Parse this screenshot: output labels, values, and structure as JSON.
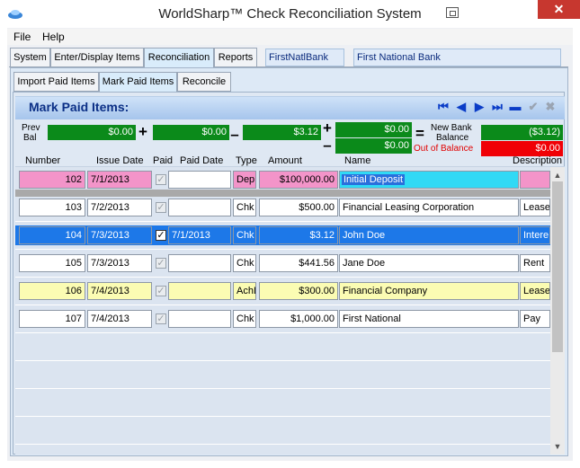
{
  "window": {
    "title": "WorldSharp™ Check Reconciliation System",
    "close_glyph": "✕"
  },
  "menu": [
    "File",
    "Help"
  ],
  "tabs": [
    "System",
    "Enter/Display Items",
    "Reconciliation",
    "Reports"
  ],
  "active_tab": "Reconciliation",
  "bank": {
    "code": "FirstNatlBank",
    "name": "First National Bank"
  },
  "subtabs": [
    "Import Paid Items",
    "Mark Paid Items",
    "Reconcile"
  ],
  "active_subtab": "Mark Paid Items",
  "panel_title": "Mark Paid Items:",
  "nav_icons": [
    "first-record-icon",
    "previous-record-icon",
    "next-record-icon",
    "last-record-icon",
    "delete-icon",
    "save-check-icon",
    "cancel-icon"
  ],
  "balances": {
    "prev_bal_label_1": "Prev",
    "prev_bal_label_2": "Bal",
    "prev_bal": "$0.00",
    "plus_value": "$0.00",
    "minus_value": "$3.12",
    "add_adjust": "$0.00",
    "sub_adjust": "$0.00",
    "new_bank_label_1": "New Bank",
    "new_bank_label_2": "Balance",
    "new_bank_balance": "($3.12)",
    "out_of_balance_label": "Out of Balance",
    "out_of_balance": "$0.00",
    "op_plus": "+",
    "op_minus": "–",
    "op_equals": "="
  },
  "columns": [
    "Number",
    "Issue Date",
    "Paid",
    "Paid Date",
    "Type",
    "Amount",
    "Name",
    "Description"
  ],
  "rows": [
    {
      "number": "102",
      "issue_date": "7/1/2013",
      "paid": true,
      "paid_date": "",
      "type": "Dep",
      "amount": "$100,000.00",
      "name": "Initial Deposit",
      "description": "",
      "style": "pink"
    },
    {
      "number": "103",
      "issue_date": "7/2/2013",
      "paid": true,
      "paid_date": "",
      "type": "Chk",
      "amount": "$500.00",
      "name": "Financial Leasing Corporation",
      "description": "Lease",
      "style": "white"
    },
    {
      "number": "104",
      "issue_date": "7/3/2013",
      "paid": true,
      "paid_date": "7/1/2013",
      "type": "Chk",
      "amount": "$3.12",
      "name": "John Doe",
      "description": "Intere",
      "style": "blue"
    },
    {
      "number": "105",
      "issue_date": "7/3/2013",
      "paid": true,
      "paid_date": "",
      "type": "Chk",
      "amount": "$441.56",
      "name": "Jane Doe",
      "description": "Rent",
      "style": "white"
    },
    {
      "number": "106",
      "issue_date": "7/4/2013",
      "paid": true,
      "paid_date": "",
      "type": "AchD",
      "amount": "$300.00",
      "name": "Financial Company",
      "description": "Lease",
      "style": "yellow"
    },
    {
      "number": "107",
      "issue_date": "7/4/2013",
      "paid": true,
      "paid_date": "",
      "type": "Chk",
      "amount": "$1,000.00",
      "name": "First National",
      "description": "Pay",
      "style": "white"
    }
  ],
  "check_glyph": "✓",
  "scroll_up": "▲",
  "scroll_down": "▼"
}
